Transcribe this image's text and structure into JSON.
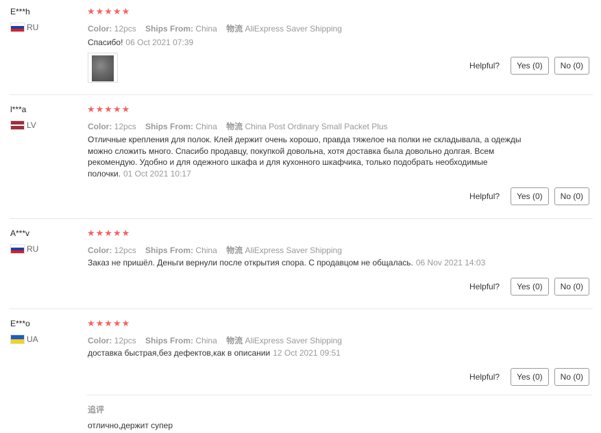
{
  "reviews": [
    {
      "user": "E***h",
      "country": "RU",
      "flag": "flag-ru",
      "stars": "★★★★★",
      "rating": 5,
      "color_label": "Color:",
      "color_value": "12pcs",
      "ships_label": "Ships From:",
      "ships_value": "China",
      "logistics_label": "物流",
      "logistics_value": "AliExpress Saver Shipping",
      "text": "Спасибо!",
      "date": "06 Oct 2021 07:39",
      "has_photo": true,
      "helpful_label": "Helpful?",
      "yes_label": "Yes (0)",
      "no_label": "No (0)"
    },
    {
      "user": "l***a",
      "country": "LV",
      "flag": "flag-lv",
      "stars": "★★★★★",
      "rating": 5,
      "color_label": "Color:",
      "color_value": "12pcs",
      "ships_label": "Ships From:",
      "ships_value": "China",
      "logistics_label": "物流",
      "logistics_value": "China Post Ordinary Small Packet Plus",
      "text_lines": [
        "Отличные крепления для полок. Клей держит очень хорошо, правда тяжелое на полки не складывала, а одежды",
        "можно сложить много. Спасибо продавцу, покупкой довольна, хотя доставка была довольно долгая. Всем",
        "рекомендую. Удобно и для одежного шкафа и для кухонного шкафчика, только подобрать необходимые",
        "полочки."
      ],
      "date": "01 Oct 2021 10:17",
      "has_photo": false,
      "helpful_label": "Helpful?",
      "yes_label": "Yes (0)",
      "no_label": "No (0)"
    },
    {
      "user": "A***v",
      "country": "RU",
      "flag": "flag-ru",
      "stars": "★★★★★",
      "rating": 5,
      "color_label": "Color:",
      "color_value": "12pcs",
      "ships_label": "Ships From:",
      "ships_value": "China",
      "logistics_label": "物流",
      "logistics_value": "AliExpress Saver Shipping",
      "text": "Заказ не пришёл. Деньги вернули после открытия спора. С продавцом не общалась.",
      "date": "06 Nov 2021 14:03",
      "has_photo": false,
      "helpful_label": "Helpful?",
      "yes_label": "Yes (0)",
      "no_label": "No (0)"
    },
    {
      "user": "E***o",
      "country": "UA",
      "flag": "flag-ua",
      "stars": "★★★★★",
      "rating": 5,
      "color_label": "Color:",
      "color_value": "12pcs",
      "ships_label": "Ships From:",
      "ships_value": "China",
      "logistics_label": "物流",
      "logistics_value": "AliExpress Saver Shipping",
      "text": "доставка быстрая,без дефектов,как в описании",
      "date": "12 Oct 2021 09:51",
      "has_photo": false,
      "helpful_label": "Helpful?",
      "yes_label": "Yes (0)",
      "no_label": "No (0)",
      "followup_title": "追评",
      "followup_text": "отлично,держит супер"
    }
  ],
  "colors": {
    "stars": "#f56262",
    "meta": "#999999",
    "separator": "#e8e8e8"
  }
}
